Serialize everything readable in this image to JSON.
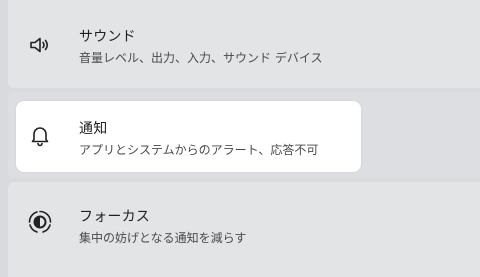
{
  "settings": {
    "sound": {
      "title": "サウンド",
      "description": "音量レベル、出力、入力、サウンド デバイス",
      "icon": "speaker-icon"
    },
    "notifications": {
      "title": "通知",
      "description": "アプリとシステムからのアラート、応答不可",
      "icon": "bell-icon"
    },
    "focus": {
      "title": "フォーカス",
      "description": "集中の妨げとなる通知を減らす",
      "icon": "focus-icon"
    }
  },
  "colors": {
    "page_bg": "#d8dadd",
    "card_bg": "#e3e4e6",
    "highlight_bg": "#ffffff",
    "title_text": "#1f1f1f",
    "desc_text": "#4a4a4a"
  }
}
